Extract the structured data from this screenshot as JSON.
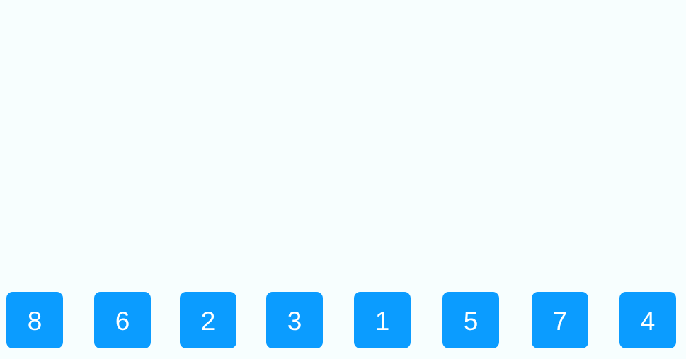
{
  "theme": {
    "background": "#f7fefe",
    "tile_color": "#0b9cff",
    "tile_text_color": "#ffffff"
  },
  "tiles": [
    {
      "label": "8"
    },
    {
      "label": "6"
    },
    {
      "label": "2"
    },
    {
      "label": "3"
    },
    {
      "label": "1"
    },
    {
      "label": "5"
    },
    {
      "label": "7"
    },
    {
      "label": "4"
    }
  ]
}
